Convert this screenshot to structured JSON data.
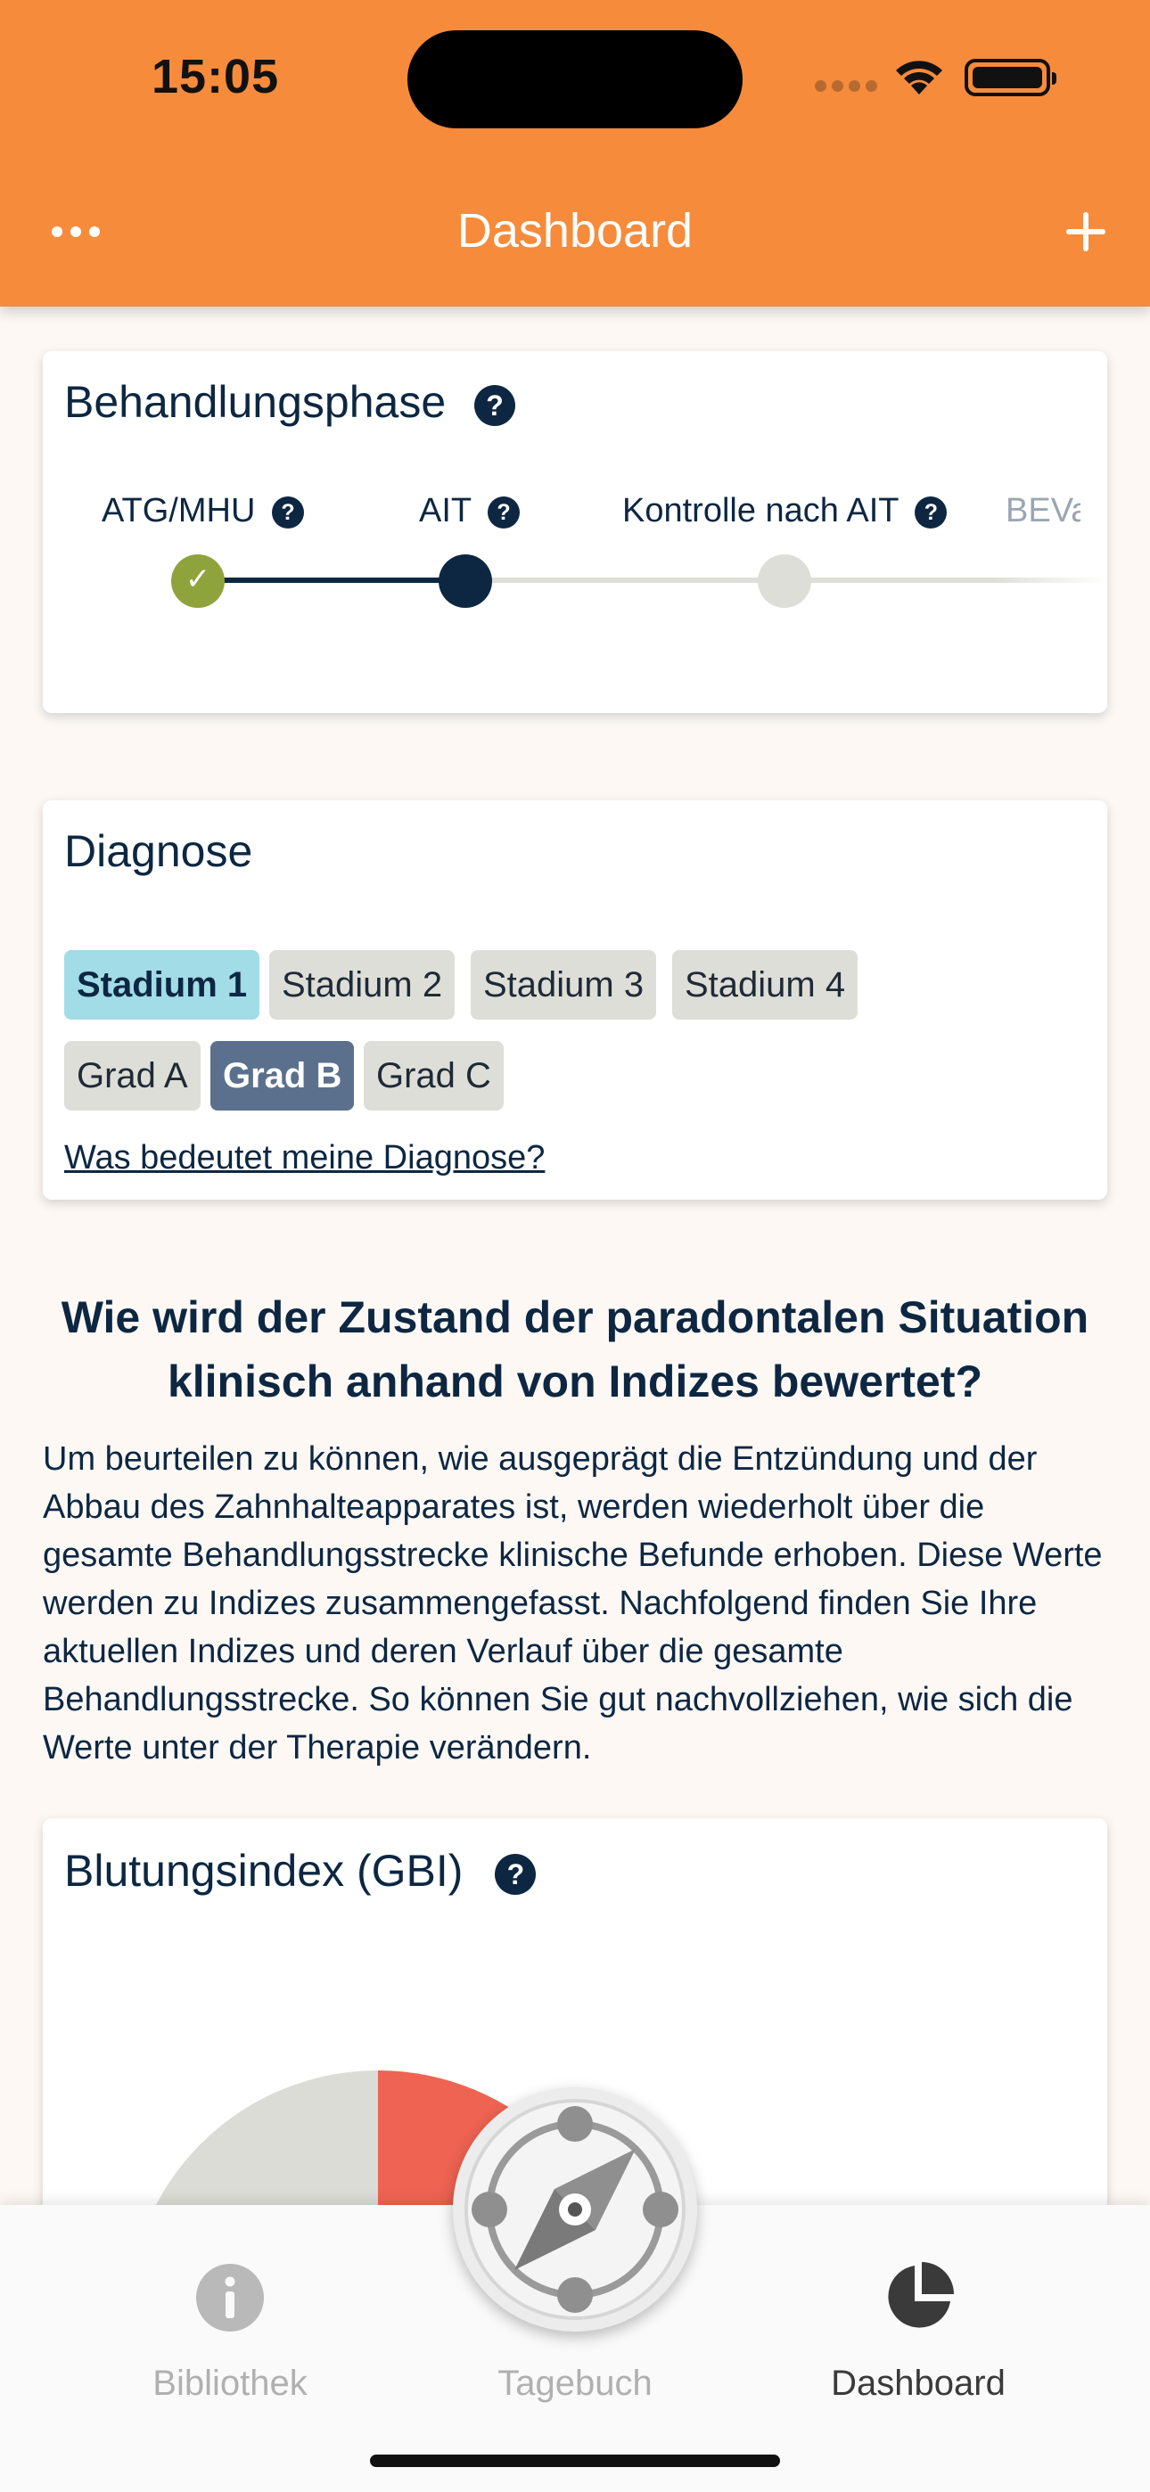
{
  "status_bar": {
    "time": "15:05"
  },
  "header": {
    "title": "Dashboard"
  },
  "phase_card": {
    "title": "Behandlungsphase",
    "help_glyph": "?",
    "steps": [
      {
        "label": "ATG/MHU",
        "state": "done"
      },
      {
        "label": "AIT",
        "state": "current"
      },
      {
        "label": "Kontrolle nach AIT",
        "state": "upcoming"
      },
      {
        "label": "BEVa",
        "state": "upcoming"
      }
    ],
    "check_glyph": "✓"
  },
  "diagnosis_card": {
    "title": "Diagnose",
    "stadien": [
      "Stadium 1",
      "Stadium 2",
      "Stadium 3",
      "Stadium 4"
    ],
    "selected_stadium": "Stadium 1",
    "grade": [
      "Grad A",
      "Grad B",
      "Grad C"
    ],
    "selected_grade": "Grad B",
    "link": "Was bedeutet meine Diagnose?"
  },
  "section": {
    "heading": "Wie wird der Zustand der paradontalen Situation klinisch anhand von Indizes bewertet?",
    "body": "Um beurteilen zu können, wie ausgeprägt die Entzündung und der Abbau des Zahnhalteapparates ist, werden wiederholt über die gesamte Behandlungsstrecke klinische Befunde erhoben. Diese Werte werden zu Indizes zusammengefasst. Nachfolgend finden Sie Ihre aktuellen Indizes und deren Verlauf über die gesamte Behandlungsstrecke. So können Sie gut nachvollziehen, wie sich die Werte unter der Therapie verändern."
  },
  "gbi_card": {
    "title": "Blutungsindex (GBI)"
  },
  "bottom_nav": {
    "items": [
      {
        "label": "Bibliothek",
        "icon": "info-icon"
      },
      {
        "label": "Tagebuch",
        "icon": "compass-icon"
      },
      {
        "label": "Dashboard",
        "icon": "pie-chart-icon"
      }
    ],
    "active": "Dashboard"
  },
  "colors": {
    "header": "#f68b3c",
    "navy": "#0d2742",
    "done_green": "#8fa33c",
    "stadium_active": "#a2dce6",
    "grade_active": "#5b708d",
    "gauge_red": "#ee6352",
    "gauge_grey": "#dcdcd6"
  }
}
